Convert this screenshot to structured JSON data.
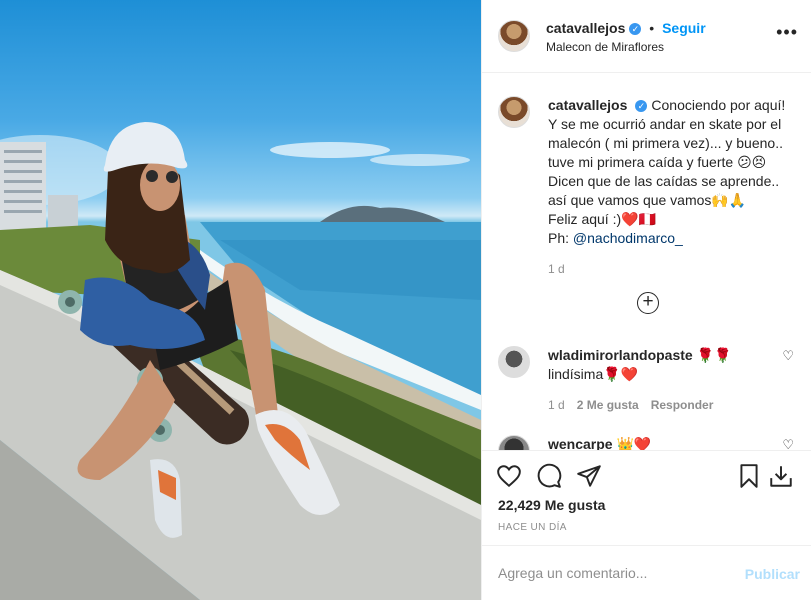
{
  "post": {
    "author": "catavallejos",
    "follow_label": "Seguir",
    "location": "Malecon de Miraflores",
    "more_label": "•••"
  },
  "caption": {
    "author": "catavallejos",
    "text": "Conociendo por aquí! Y se me ocurrió andar en skate por el malecón ( mi primera vez)... y bueno.. tuve mi primera caída y fuerte 😕😣 Dicen que de las caídas se aprende.. así que vamos que vamos🙌🙏",
    "line2": "Feliz aquí :)❤️🇵🇪",
    "credit_prefix": "Ph: ",
    "credit_tag": "@nachodimarco_",
    "time": "1 d"
  },
  "load_more_label": "+",
  "comments": [
    {
      "author": "wladimirorlandopaste 🌹🌹",
      "text": "lindísima🌹❤️",
      "time": "1 d",
      "likes": "2 Me gusta",
      "reply": "Responder"
    },
    {
      "author": "wencarpe 👑❤️",
      "text": ""
    }
  ],
  "actions": {
    "likes": "22,429 Me gusta",
    "posted": "HACE UN DÍA"
  },
  "compose": {
    "placeholder": "Agrega un comentario...",
    "publish_label": "Publicar"
  },
  "colors": {
    "link": "#0095f6",
    "publish_disabled": "#b2dffc",
    "muted": "#8e8e8e",
    "text": "#262626"
  }
}
